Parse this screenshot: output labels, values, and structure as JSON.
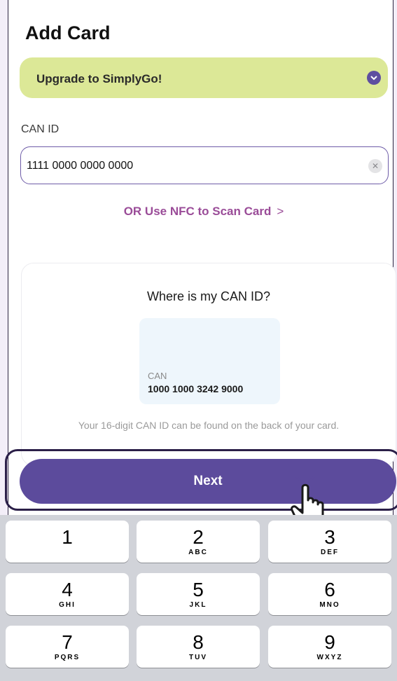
{
  "page": {
    "title": "Add Card"
  },
  "upgrade": {
    "label": "Upgrade to SimplyGo!",
    "icon": "chevron-down-icon"
  },
  "can_field": {
    "label": "CAN ID",
    "value": "1111 0000 0000 0000",
    "clear_icon": "clear-icon"
  },
  "nfc_link": {
    "label": "OR Use NFC to Scan Card",
    "arrow": ">"
  },
  "help": {
    "title": "Where is my CAN ID?",
    "card_label": "CAN",
    "card_number": "1000 1000 3242 9000",
    "caption": "Your 16-digit CAN ID can be found on the back of your card."
  },
  "next_button": {
    "label": "Next"
  },
  "keypad": [
    {
      "digit": "1",
      "letters": ""
    },
    {
      "digit": "2",
      "letters": "ABC"
    },
    {
      "digit": "3",
      "letters": "DEF"
    },
    {
      "digit": "4",
      "letters": "GHI"
    },
    {
      "digit": "5",
      "letters": "JKL"
    },
    {
      "digit": "6",
      "letters": "MNO"
    },
    {
      "digit": "7",
      "letters": "PQRS"
    },
    {
      "digit": "8",
      "letters": "TUV"
    },
    {
      "digit": "9",
      "letters": "WXYZ"
    }
  ],
  "colors": {
    "accent": "#5c4b9c",
    "upgrade_bg": "#dce897",
    "link": "#9a4c98"
  }
}
